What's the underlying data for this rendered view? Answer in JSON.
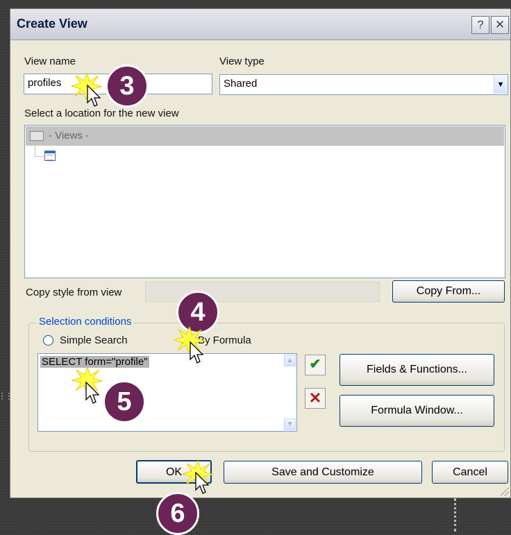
{
  "dialog": {
    "title": "Create View",
    "help_label": "?",
    "close_label": "✕"
  },
  "form": {
    "view_name_label": "View name",
    "view_name_value": "profiles",
    "view_type_label": "View type",
    "view_type_value": "Shared",
    "location_label": "Select a location for the new view",
    "tree_root": "- Views -",
    "copy_style_label": "Copy style from view",
    "copy_from_button": "Copy From..."
  },
  "selection": {
    "legend": "Selection conditions",
    "simple_search_label": "Simple Search",
    "by_formula_label": "By Formula",
    "selected_mode": "By Formula",
    "formula_text": "SELECT form=\"profile\"",
    "fields_functions_button": "Fields & Functions...",
    "formula_window_button": "Formula Window..."
  },
  "footer": {
    "ok_button": "OK",
    "save_customize_button": "Save and Customize",
    "cancel_button": "Cancel"
  },
  "step_badges": [
    "3",
    "4",
    "5",
    "6"
  ],
  "colors": {
    "badge": "#6b2456",
    "check": "#1a8a1a",
    "cross": "#b01818",
    "selection_highlight": "#b4b4b4"
  }
}
